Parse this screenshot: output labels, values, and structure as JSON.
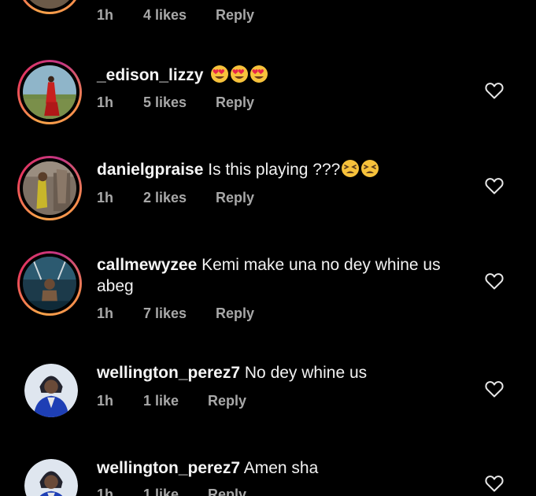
{
  "comments": [
    {
      "username": "",
      "text": "",
      "time": "1h",
      "likes": "4 likes",
      "reply": "Reply"
    },
    {
      "username": "_edison_lizzy",
      "text": "",
      "emoji": [
        "heart-eyes-emoji",
        "heart-eyes-emoji",
        "heart-eyes-emoji"
      ],
      "time": "1h",
      "likes": "5 likes",
      "reply": "Reply"
    },
    {
      "username": "danielgpraise",
      "text": "Is this playing ???",
      "emoji": [
        "tired-face-emoji",
        "tired-face-emoji"
      ],
      "time": "1h",
      "likes": "2 likes",
      "reply": "Reply"
    },
    {
      "username": "callmewyzee",
      "text": "Kemi make una no dey whine us abeg",
      "time": "1h",
      "likes": "7 likes",
      "reply": "Reply"
    },
    {
      "username": "wellington_perez7",
      "text": "No dey whine us",
      "time": "1h",
      "likes": "1 like",
      "reply": "Reply"
    },
    {
      "username": "wellington_perez7",
      "text": "Amen sha",
      "time": "1h",
      "likes": "1 like",
      "reply": "Reply"
    }
  ],
  "colors": {
    "background": "#000000",
    "text": "#f2f2f2",
    "meta": "#a8a8a8",
    "story_ring_start": "#f9a34a",
    "story_ring_end": "#c13584"
  },
  "icons": {
    "like": "heart-outline-icon"
  }
}
